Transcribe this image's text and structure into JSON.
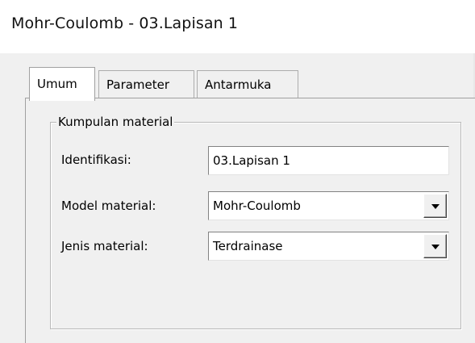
{
  "window": {
    "title": "Mohr-Coulomb - 03.Lapisan 1"
  },
  "tabs": [
    {
      "label": "Umum",
      "active": true
    },
    {
      "label": "Parameter",
      "active": false
    },
    {
      "label": "Antarmuka",
      "active": false
    }
  ],
  "group": {
    "title": "Kumpulan material",
    "fields": {
      "identifikasi": {
        "label": "Identifikasi:",
        "value": "03.Lapisan 1"
      },
      "model_material": {
        "label": "Model material:",
        "value": "Mohr-Coulomb"
      },
      "jenis_material": {
        "label": "Jenis material:",
        "value": "Terdrainase"
      }
    }
  },
  "icons": {
    "dropdown": "chevron-down-icon"
  }
}
